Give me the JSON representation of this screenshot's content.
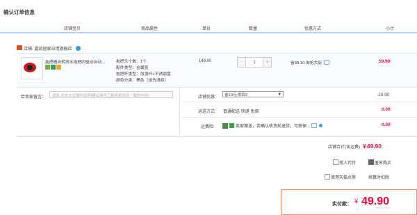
{
  "page": {
    "title": "确认订单信息"
  },
  "columns": [
    "店铺宝贝",
    "商品属性",
    "单价",
    "数量",
    "优惠方式",
    "小计"
  ],
  "shop": {
    "prefix": "店铺:",
    "name": "嘉凯居家日用旗舰店"
  },
  "item": {
    "title": "拖把桶自转挤水拖把四驱动自动...",
    "attrs": [
      "拖把头个数：1个",
      "配件类型：金属篮",
      "拖把杆类型：加强杆+不锈钢盘",
      "颜色分类：黑色（送洗浪瓶）"
    ],
    "price": "148.00",
    "qty": "1",
    "qty_minus": "-",
    "qty_plus": "+",
    "promo": "省88.10:淘抢大促",
    "subtotal": "59.90"
  },
  "message": {
    "label": "给卖家留言：",
    "placeholder": "选填:对本次交易的说明(建议填写已和卖家协商一致的内容)"
  },
  "shop_discount": {
    "label": "店铺优惠:",
    "selected": "省10元:供回2",
    "amount": "-10.00"
  },
  "shipping": {
    "label": "运送方式:",
    "value": "普通配送 快递 免邮",
    "amount": "0.00"
  },
  "insurance": {
    "label": "运费险:",
    "text": "卖家赠送，若确认收货前退货，可获保...",
    "amount": "0.00"
  },
  "shop_total": {
    "label": "店铺合计(含运费)",
    "currency": "¥",
    "value": "49.90"
  },
  "options": {
    "anonymous_pay": "找人代付",
    "anonymous_buy": "匿名购买",
    "tmall_points": "使用天猫点券",
    "tail": "续算时扣除"
  },
  "final": {
    "label": "实付款：",
    "currency": "¥",
    "value": "49.90"
  },
  "watermark": "tmall.com",
  "colors": {
    "accent_red": "#ff0036",
    "header_line": "#b2d1ff",
    "final_border": "#ff8f5a"
  }
}
